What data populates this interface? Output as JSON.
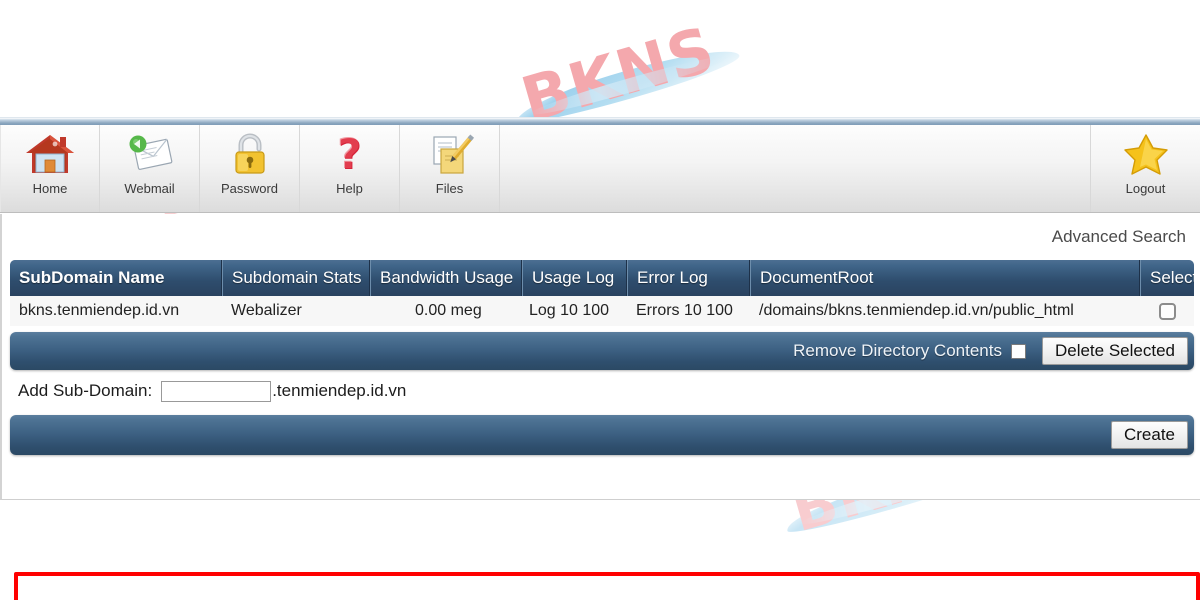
{
  "toolbar": {
    "items": [
      {
        "id": "home",
        "label": "Home",
        "icon": "home-icon"
      },
      {
        "id": "webmail",
        "label": "Webmail",
        "icon": "webmail-icon"
      },
      {
        "id": "password",
        "label": "Password",
        "icon": "padlock-icon"
      },
      {
        "id": "help",
        "label": "Help",
        "icon": "question-mark-icon"
      },
      {
        "id": "files",
        "label": "Files",
        "icon": "files-icon"
      }
    ],
    "logout": {
      "label": "Logout",
      "icon": "star-icon"
    }
  },
  "content": {
    "advanced_search": "Advanced Search"
  },
  "table": {
    "columns": [
      "SubDomain Name",
      "Subdomain Stats",
      "Bandwidth Usage",
      "Usage Log",
      "Error Log",
      "DocumentRoot",
      "Select"
    ],
    "rows": [
      {
        "name": "bkns.tenmiendep.id.vn",
        "stats": "Webalizer",
        "bandwidth": "0.00 meg",
        "usage_log": "Log 10 100",
        "error_log": "Errors 10 100",
        "document_root": "/domains/bkns.tenmiendep.id.vn/public_html",
        "selected": false
      }
    ]
  },
  "delete_bar": {
    "remove_label": "Remove Directory Contents",
    "remove_checked": false,
    "delete_button": "Delete Selected"
  },
  "add_row": {
    "label": "Add Sub-Domain:",
    "input_value": "",
    "input_placeholder": "",
    "suffix": ".tenmiendep.id.vn"
  },
  "create_bar": {
    "create_button": "Create"
  },
  "watermark": {
    "text": "BKNS",
    "text_color": "#f4a8ad",
    "swoosh_color": "#8ecaea"
  },
  "annotation": {
    "highlight_color": "#ff0000"
  },
  "theme": {
    "header_blue": "#2e4d6d",
    "bar_blue": "#3d6183",
    "page_background": "#ffffff",
    "row_background": "#f7f7f7"
  }
}
